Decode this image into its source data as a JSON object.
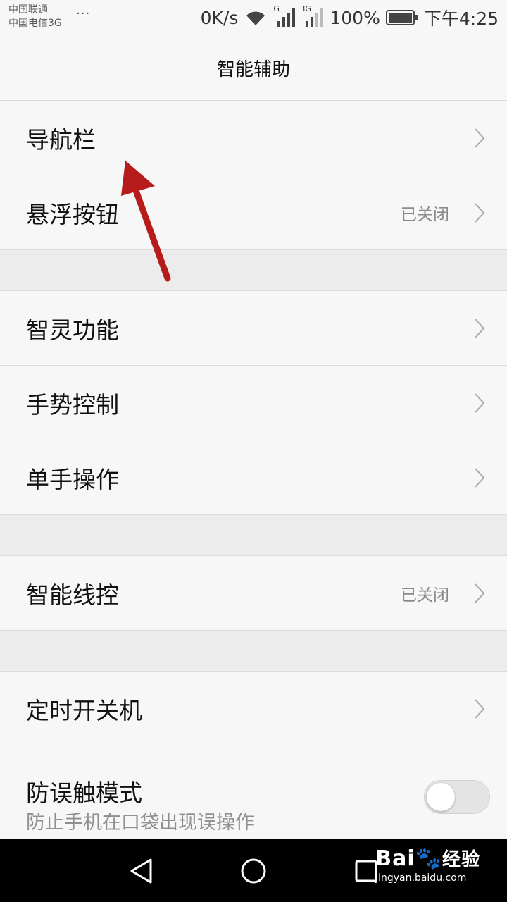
{
  "status_bar": {
    "carrier1": "中国联通",
    "carrier2": "中国电信3G",
    "more": "···",
    "speed": "0K/s",
    "sim1_tag": "G",
    "sim2_tag": "3G",
    "battery": "100%",
    "time": "下午4:25"
  },
  "header": {
    "title": "智能辅助"
  },
  "items": [
    {
      "label": "导航栏",
      "status": ""
    },
    {
      "label": "悬浮按钮",
      "status": "已关闭"
    },
    {
      "label": "智灵功能",
      "status": ""
    },
    {
      "label": "手势控制",
      "status": ""
    },
    {
      "label": "单手操作",
      "status": ""
    },
    {
      "label": "智能线控",
      "status": "已关闭"
    },
    {
      "label": "定时开关机",
      "status": ""
    },
    {
      "label": "防误触模式",
      "subtitle": "防止手机在口袋出现误操作",
      "toggle_on": false
    }
  ],
  "watermark": {
    "brand_latin": "Bai",
    "brand_cn": "经验",
    "url": "jingyan.baidu.com"
  },
  "colors": {
    "annotation_arrow": "#b71c1c",
    "background": "#f7f7f7",
    "divider": "#dcdcdc"
  }
}
